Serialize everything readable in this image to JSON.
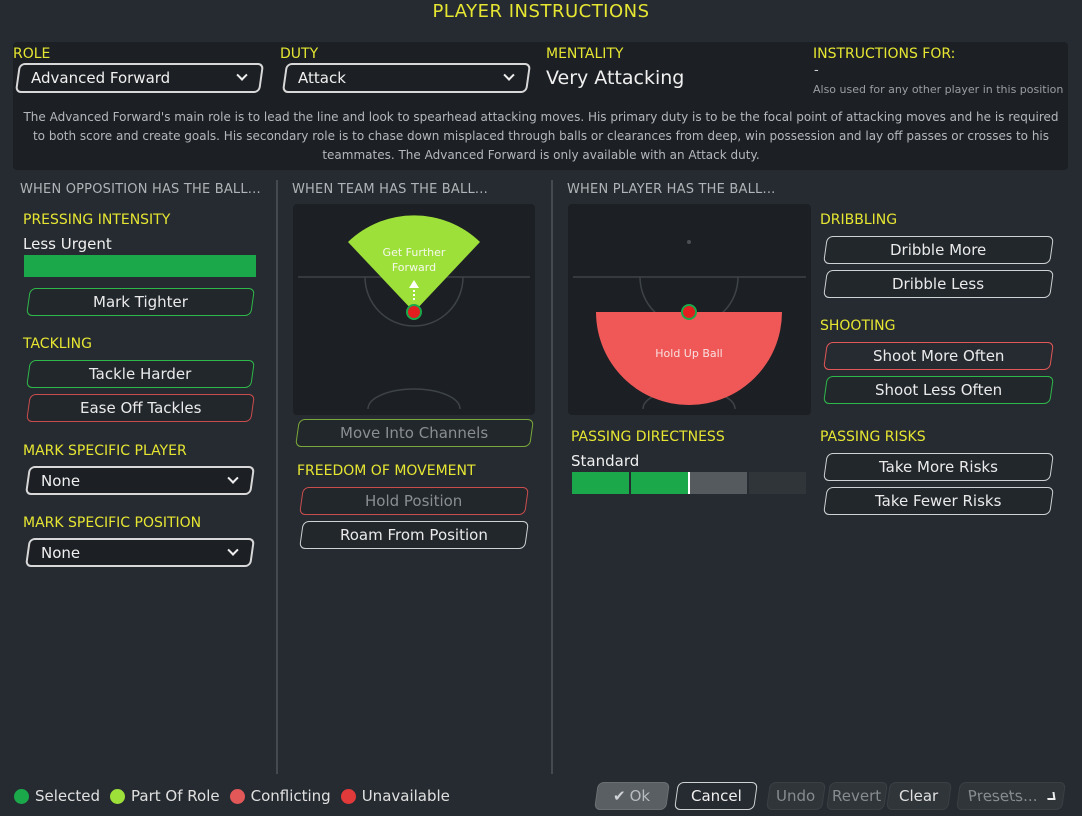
{
  "window": {
    "title": "PLAYER INSTRUCTIONS"
  },
  "header": {
    "role_label": "ROLE",
    "role_value": "Advanced Forward",
    "duty_label": "DUTY",
    "duty_value": "Attack",
    "mentality_label": "MENTALITY",
    "mentality_value": "Very Attacking",
    "instructions_for_label": "INSTRUCTIONS FOR:",
    "instructions_for_value": "-",
    "instructions_for_note": "Also used for any other player in this position",
    "description": "The Advanced Forward's main role is to lead the line and look to spearhead attacking moves. His primary duty is to be the focal point of attacking moves and he is required to both score and create goals. His secondary role is to chase down misplaced through balls or clearances from deep, win possession and lay off passes or crosses to his teammates. The Advanced Forward is only available with an Attack duty."
  },
  "opposition": {
    "heading": "WHEN OPPOSITION HAS THE BALL...",
    "pressing_label": "PRESSING INTENSITY",
    "pressing_value": "Less Urgent",
    "pressing_level": 1.0,
    "mark_tighter": "Mark Tighter",
    "tackling_label": "TACKLING",
    "tackle_harder": "Tackle Harder",
    "ease_off": "Ease Off Tackles",
    "mark_player_label": "MARK SPECIFIC PLAYER",
    "mark_player_value": "None",
    "mark_position_label": "MARK SPECIFIC POSITION",
    "mark_position_value": "None"
  },
  "team": {
    "heading": "WHEN TEAM HAS THE BALL...",
    "zone_label_1": "Get Further",
    "zone_label_2": "Forward",
    "move_channels": "Move Into Channels",
    "freedom_label": "FREEDOM OF MOVEMENT",
    "hold_position": "Hold Position",
    "roam": "Roam From Position"
  },
  "player": {
    "heading": "WHEN PLAYER HAS THE BALL...",
    "zone_label": "Hold Up Ball",
    "dribbling_label": "DRIBBLING",
    "dribble_more": "Dribble More",
    "dribble_less": "Dribble Less",
    "shooting_label": "SHOOTING",
    "shoot_more": "Shoot More Often",
    "shoot_less": "Shoot Less Often",
    "passing_dir_label": "PASSING DIRECTNESS",
    "passing_dir_value": "Standard",
    "passing_level": 0.5,
    "passing_risks_label": "PASSING RISKS",
    "more_risks": "Take More Risks",
    "fewer_risks": "Take Fewer Risks"
  },
  "legend": {
    "selected": "Selected",
    "part_of_role": "Part Of Role",
    "conflicting": "Conflicting",
    "unavailable": "Unavailable"
  },
  "footer": {
    "ok": "Ok",
    "cancel": "Cancel",
    "undo": "Undo",
    "revert": "Revert",
    "clear": "Clear",
    "presets": "Presets..."
  },
  "colors": {
    "accent_yellow": "#e6e632",
    "selected_green": "#1aa84a",
    "part_of_role": "#9ee03a",
    "conflicting": "#e25757",
    "unavailable": "#e23a3a"
  }
}
